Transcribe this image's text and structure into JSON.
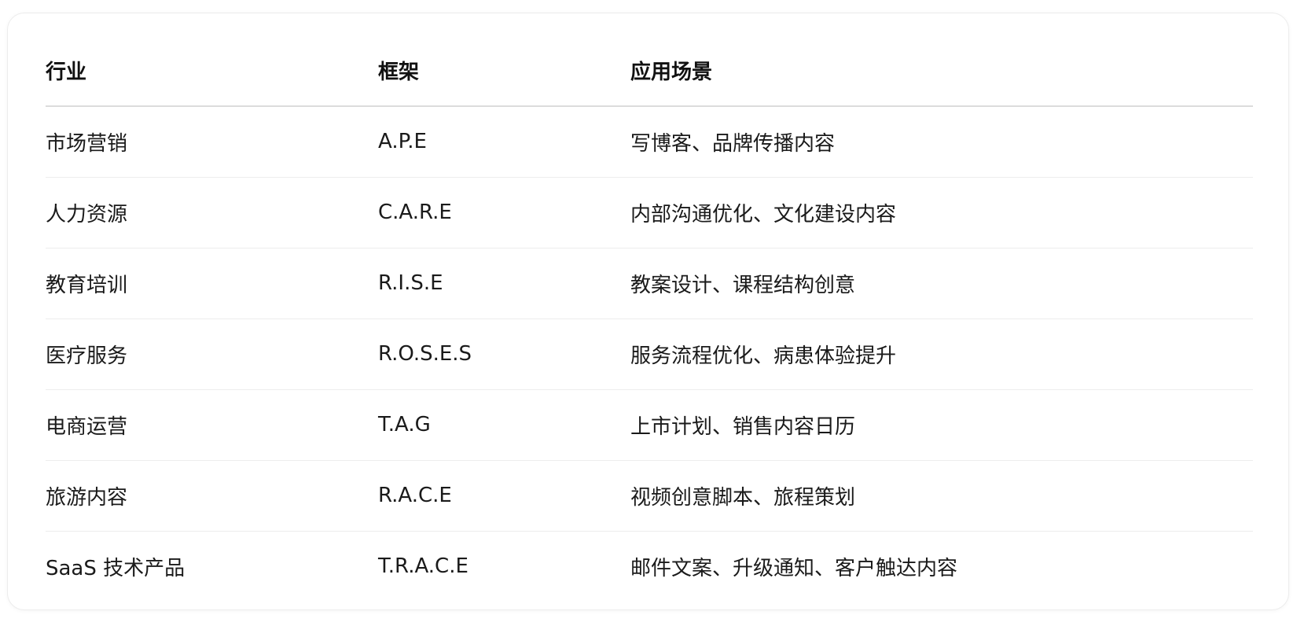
{
  "table": {
    "headers": [
      "行业",
      "框架",
      "应用场景"
    ],
    "rows": [
      [
        "市场营销",
        "A.P.E",
        "写博客、品牌传播内容"
      ],
      [
        "人力资源",
        "C.A.R.E",
        "内部沟通优化、文化建设内容"
      ],
      [
        "教育培训",
        "R.I.S.E",
        "教案设计、课程结构创意"
      ],
      [
        "医疗服务",
        "R.O.S.E.S",
        "服务流程优化、病患体验提升"
      ],
      [
        "电商运营",
        "T.A.G",
        "上市计划、销售内容日历"
      ],
      [
        "旅游内容",
        "R.A.C.E",
        "视频创意脚本、旅程策划"
      ],
      [
        "SaaS 技术产品",
        "T.R.A.C.E",
        "邮件文案、升级通知、客户触达内容"
      ]
    ]
  }
}
